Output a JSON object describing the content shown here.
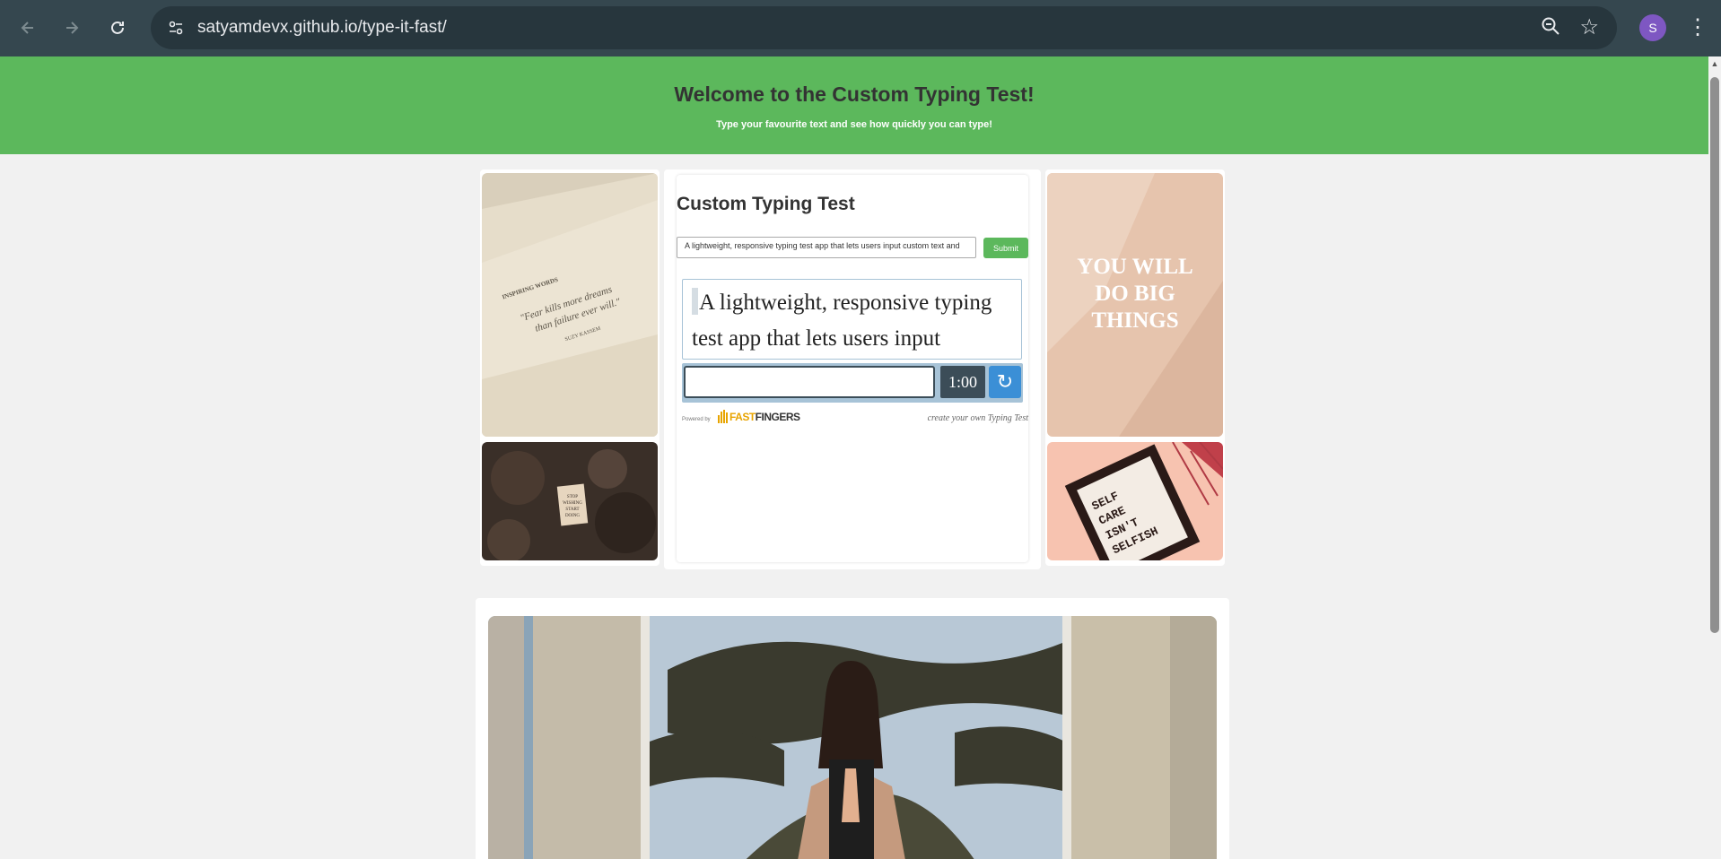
{
  "browser": {
    "url_host": "satyamdevx.github.io",
    "url_path": "/type-it-fast/",
    "profile_initial": "S",
    "icons": [
      "back-icon",
      "forward-icon",
      "reload-icon",
      "site-settings-icon",
      "zoom-icon",
      "bookmark-star-icon",
      "menu-icon"
    ]
  },
  "hero": {
    "title": "Welcome to the Custom Typing Test!",
    "subtitle": "Type your favourite text and see how quickly you can type!"
  },
  "typing_test": {
    "title": "Custom Typing Test",
    "custom_text_value": "A lightweight, responsive typing test app that lets users input custom text and",
    "submit_label": "Submit",
    "words_line1": "A lightweight, responsive typing",
    "words_line2": "test app that lets users input",
    "timer": "1:00",
    "reload_symbol": "↻",
    "powered_by": "Powered by",
    "logo_fast": "FAST",
    "logo_fingers": "FINGERS",
    "create_link": "create your own Typing Test"
  },
  "images": {
    "left_top": {
      "line1": "INSPIRING WORDS",
      "line2": "\"Fear kills more dreams",
      "line3": "than failure ever will.\"",
      "line4": "SUZY KASSEM"
    },
    "left_bottom": {
      "line1": "STOP",
      "line2": "WISHING",
      "line3": "START",
      "line4": "DOING"
    },
    "right_top": {
      "line1": "YOU WILL",
      "line2": "DO BIG",
      "line3": "THINGS"
    },
    "right_bottom": {
      "line1": "SELF",
      "line2": "CARE",
      "line3": "ISN'T",
      "line4": "SELFISH"
    }
  },
  "colors": {
    "hero_bg": "#5cb85c",
    "chrome_bg": "#35474f",
    "timer_bg": "#3c4d58",
    "reload_bg": "#3b8fd6"
  }
}
